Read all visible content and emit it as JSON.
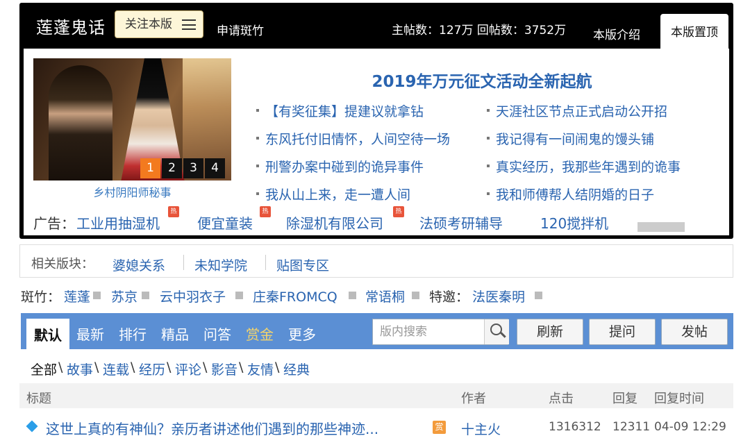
{
  "header": {
    "title": "莲蓬鬼话",
    "follow_label": "关注本版",
    "apply_label": "申请斑竹",
    "stats": "主帖数：127万 回帖数：3752万",
    "tabs": [
      "本版介绍",
      "本版置顶"
    ]
  },
  "slideshow": {
    "caption": "乡村阴阳师秘事",
    "pages": [
      "1",
      "2",
      "3",
      "4"
    ],
    "active_page": "1"
  },
  "banner": "2019年万元征文活动全新起航",
  "news": [
    "【有奖征集】提建议就拿钻",
    "天涯社区节点正式启动公开招",
    "东风托付旧情怀，人间空待一场",
    "我记得有一间闹鬼的馒头铺",
    "刑警办案中碰到的诡异事件",
    "真实经历，我那些年遇到的诡事",
    "我从山上来，走一遭人间",
    "我和师傅帮人结阴婚的日子"
  ],
  "ads": {
    "label": "广告：",
    "hot_badge": "热",
    "items": [
      {
        "text": "工业用抽湿机",
        "hot": true
      },
      {
        "text": "便宜童装",
        "hot": true
      },
      {
        "text": "除湿机有限公司",
        "hot": true
      },
      {
        "text": "法硕考研辅导",
        "hot": false
      },
      {
        "text": "120搅拌机",
        "hot": false
      }
    ]
  },
  "related": {
    "label": "相关版块：",
    "items": [
      "婆媳关系",
      "未知学院",
      "贴图专区"
    ]
  },
  "moderators": {
    "label": "斑竹：",
    "items": [
      "莲蓬",
      "苏京",
      "云中羽衣子",
      "庄秦FROMCQ",
      "常语桐"
    ],
    "guest_label": "特邀：",
    "guests": [
      "法医秦明"
    ]
  },
  "toolbar": {
    "tabs": [
      "默认",
      "最新",
      "排行",
      "精品",
      "问答",
      "赏金",
      "更多"
    ],
    "search_placeholder": "版内搜索",
    "buttons": [
      "刷新",
      "提问",
      "发帖"
    ]
  },
  "categories": [
    "全部",
    "故事",
    "连载",
    "经历",
    "评论",
    "影音",
    "友情",
    "经典"
  ],
  "category_separator": "\\",
  "table": {
    "headers": [
      "标题",
      "作者",
      "点击",
      "回复",
      "回复时间"
    ],
    "rows": [
      {
        "title": "这世上真的有神仙？亲历者讲述他们遇到的那些神迹...",
        "badge": "赏",
        "author": "十主火",
        "clicks": "1316312",
        "replies": "12311",
        "time": "04-09 12:29"
      }
    ]
  },
  "colors": {
    "link": "#2a64b0",
    "toolbar": "#5b8fd4",
    "active_page": "#f37a1f",
    "hot_badge": "#e8543a",
    "reward_badge": "#f39b3c",
    "gold_tab": "#f6d56a"
  }
}
